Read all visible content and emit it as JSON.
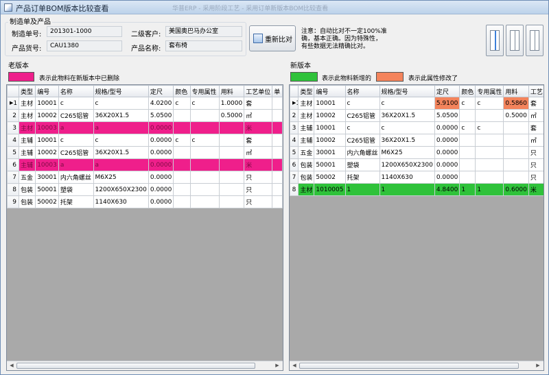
{
  "window": {
    "title": "产品订单BOM版本比较查看",
    "title_ghost": "华普ERP - 采用阶段工艺 - 采用订单新版本BOM比较查看"
  },
  "header": {
    "group_title": "制造单及产品",
    "order_no_label": "制造单号:",
    "order_no": "201301-1000",
    "product_no_label": "产品货号:",
    "product_no": "CAU1380",
    "customer_label": "二级客户:",
    "customer": "美国奥巴马办公室",
    "product_name_label": "产品名称:",
    "product_name": "套布椅",
    "compare_button": "重新比对",
    "note_lines": [
      "注意：自动比对不一定100%准",
      "确，基本正确。因为特殊性，",
      "有些数据无法精确比对。"
    ]
  },
  "legend": {
    "deleted_color": "#ef1f8b",
    "deleted_text": "表示此物料在新版本中已删除",
    "added_color": "#2fc23a",
    "added_text": "表示此物料新增的",
    "changed_color": "#f4845c",
    "changed_text": "表示此属性修改了"
  },
  "old_version": {
    "section_label": "老版本",
    "columns": [
      "类型",
      "编号",
      "名称",
      "规格/型号",
      "定尺",
      "颜色",
      "专用属性",
      "用料",
      "工艺单位",
      "单"
    ],
    "rows": [
      {
        "num": "1",
        "type": "主材",
        "code": "10001",
        "name": "c",
        "spec": "c",
        "size": "4.0200",
        "color": "c",
        "attr": "c",
        "usage": "1.0000",
        "unit": "套",
        "status": "normal",
        "current": true
      },
      {
        "num": "2",
        "type": "主材",
        "code": "10002",
        "name": "C265铝管",
        "spec": "36X20X1.5",
        "size": "5.0500",
        "color": "",
        "attr": "",
        "usage": "0.5000",
        "unit": "㎡",
        "status": "normal"
      },
      {
        "num": "3",
        "type": "主材",
        "code": "10003",
        "name": "a",
        "spec": "a",
        "size": "0.0000",
        "color": "",
        "attr": "",
        "usage": "",
        "unit": "米",
        "status": "deleted"
      },
      {
        "num": "4",
        "type": "主辅",
        "code": "10001",
        "name": "c",
        "spec": "c",
        "size": "0.0000",
        "color": "c",
        "attr": "c",
        "usage": "",
        "unit": "套",
        "status": "normal"
      },
      {
        "num": "5",
        "type": "主辅",
        "code": "10002",
        "name": "C265铝管",
        "spec": "36X20X1.5",
        "size": "0.0000",
        "color": "",
        "attr": "",
        "usage": "",
        "unit": "㎡",
        "status": "normal"
      },
      {
        "num": "6",
        "type": "主辅",
        "code": "10003",
        "name": "a",
        "spec": "a",
        "size": "0.0000",
        "color": "",
        "attr": "",
        "usage": "",
        "unit": "米",
        "status": "deleted"
      },
      {
        "num": "7",
        "type": "五金",
        "code": "30001",
        "name": "内六角螺丝",
        "spec": "M6X25",
        "size": "0.0000",
        "color": "",
        "attr": "",
        "usage": "",
        "unit": "只",
        "status": "normal"
      },
      {
        "num": "8",
        "type": "包装",
        "code": "50001",
        "name": "塑袋",
        "spec": "1200X650X2300",
        "size": "0.0000",
        "color": "",
        "attr": "",
        "usage": "",
        "unit": "只",
        "status": "normal"
      },
      {
        "num": "9",
        "type": "包装",
        "code": "50002",
        "name": "托架",
        "spec": "1140X630",
        "size": "0.0000",
        "color": "",
        "attr": "",
        "usage": "",
        "unit": "只",
        "status": "normal"
      }
    ]
  },
  "new_version": {
    "section_label": "新版本",
    "columns": [
      "类型",
      "编号",
      "名称",
      "规格/型号",
      "定尺",
      "颜色",
      "专用属性",
      "用料",
      "工艺"
    ],
    "rows": [
      {
        "num": "1",
        "type": "主材",
        "code": "10001",
        "name": "c",
        "spec": "c",
        "size": "5.9100",
        "color": "c",
        "attr": "c",
        "usage": "0.5860",
        "unit": "套",
        "status": "normal",
        "current": true,
        "changed": [
          "size",
          "usage"
        ]
      },
      {
        "num": "2",
        "type": "主材",
        "code": "10002",
        "name": "C265铝管",
        "spec": "36X20X1.5",
        "size": "5.0500",
        "color": "",
        "attr": "",
        "usage": "0.5000",
        "unit": "㎡",
        "status": "normal"
      },
      {
        "num": "3",
        "type": "主辅",
        "code": "10001",
        "name": "c",
        "spec": "c",
        "size": "0.0000",
        "color": "c",
        "attr": "c",
        "usage": "",
        "unit": "套",
        "status": "normal"
      },
      {
        "num": "4",
        "type": "主辅",
        "code": "10002",
        "name": "C265铝管",
        "spec": "36X20X1.5",
        "size": "0.0000",
        "color": "",
        "attr": "",
        "usage": "",
        "unit": "㎡",
        "status": "normal"
      },
      {
        "num": "5",
        "type": "五金",
        "code": "30001",
        "name": "内六角螺丝",
        "spec": "M6X25",
        "size": "0.0000",
        "color": "",
        "attr": "",
        "usage": "",
        "unit": "只",
        "status": "normal"
      },
      {
        "num": "6",
        "type": "包装",
        "code": "50001",
        "name": "塑袋",
        "spec": "1200X650X2300",
        "size": "0.0000",
        "color": "",
        "attr": "",
        "usage": "",
        "unit": "只",
        "status": "normal"
      },
      {
        "num": "7",
        "type": "包装",
        "code": "50002",
        "name": "托架",
        "spec": "1140X630",
        "size": "0.0000",
        "color": "",
        "attr": "",
        "usage": "",
        "unit": "只",
        "status": "normal"
      },
      {
        "num": "8",
        "type": "主材",
        "code": "1010005",
        "name": "1",
        "spec": "1",
        "size": "4.8400",
        "color": "1",
        "attr": "1",
        "usage": "0.6000",
        "unit": "米",
        "status": "added"
      }
    ]
  }
}
